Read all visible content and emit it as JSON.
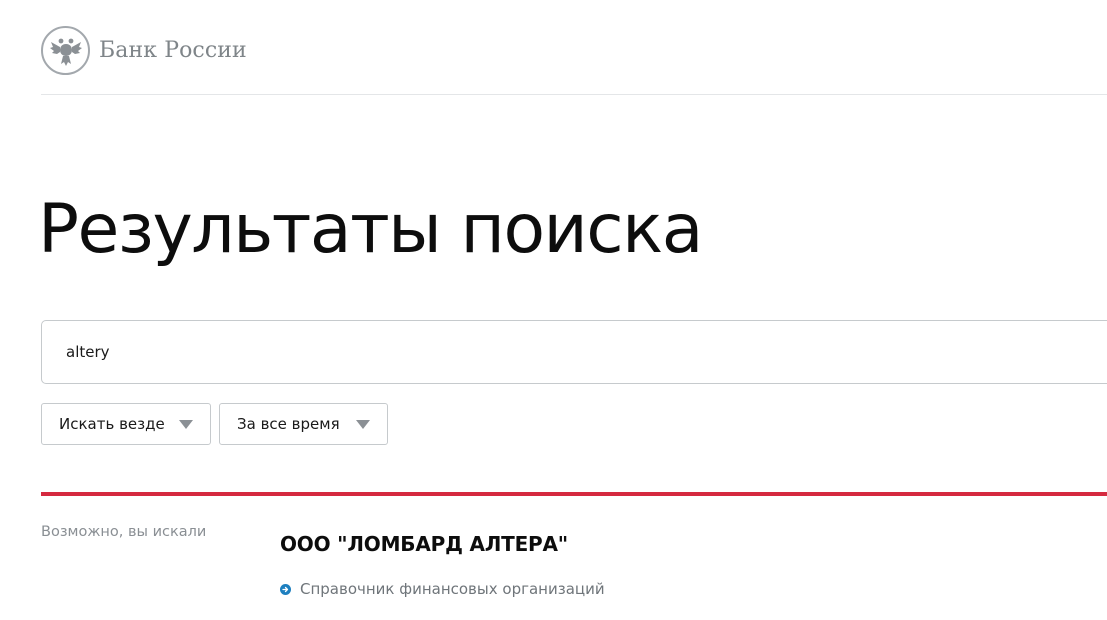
{
  "header": {
    "bank_name": "Банк России"
  },
  "page": {
    "title": "Результаты поиска"
  },
  "search": {
    "value": "altery"
  },
  "filters": {
    "where_label": "Искать везде",
    "when_label": "За все время"
  },
  "results": {
    "suggest_label": "Возможно, вы искали",
    "items": [
      {
        "title": "ООО \"ЛОМБАРД АЛТЕРА\"",
        "source": "Справочник финансовых организаций"
      }
    ]
  },
  "colors": {
    "accent_red": "#d5293f",
    "link_blue": "#1d7fbf",
    "muted_gray": "#8a8f94"
  }
}
